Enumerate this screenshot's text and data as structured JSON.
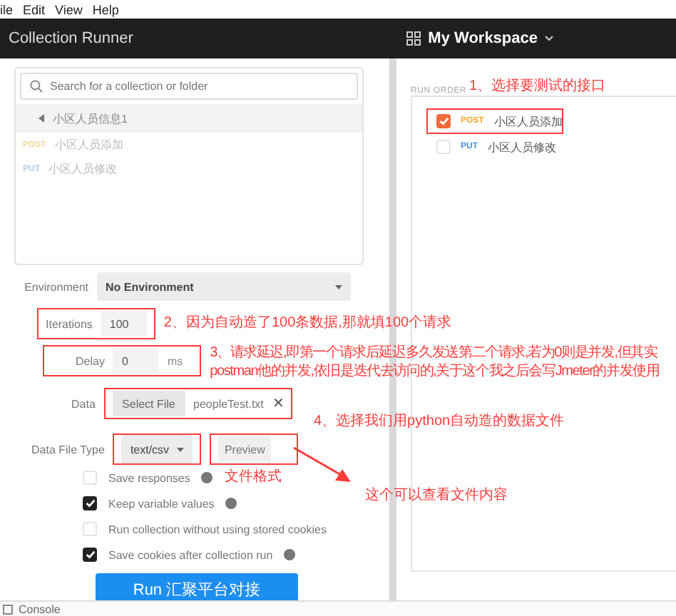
{
  "menu": [
    "ile",
    "Edit",
    "View",
    "Help"
  ],
  "header": {
    "title": "Collection Runner",
    "workspace": "My Workspace"
  },
  "collections": {
    "placeholder": "Search for a collection or folder",
    "folder": "小区人员信息1",
    "requests": [
      {
        "method": "POST",
        "name": "小区人员添加"
      },
      {
        "method": "PUT",
        "name": "小区人员修改"
      }
    ]
  },
  "environment": {
    "label": "Environment",
    "value": "No Environment"
  },
  "iterations": {
    "label": "Iterations",
    "value": "100",
    "highlighted": true,
    "note": "2、因为自动造了100条数据,那就填100个请求"
  },
  "delay": {
    "label": "Delay",
    "value": "0",
    "unit": "ms",
    "highlighted": true,
    "note": [
      "3、请求延迟,即第一个请求后延迟多久发送第二个请求,若为0则是并发,但其实",
      "postman他的并发,依旧是迭代去访问的,关于这个我之后会写Jmeter的并发使用"
    ]
  },
  "data": {
    "label": "Data",
    "button": "Select File",
    "file": "peopleTest.txt",
    "clear": "✕",
    "highlighted": true,
    "note": "4、选择我们用python自动造的数据文件"
  },
  "data_file_type": {
    "label": "Data File Type",
    "value": "text/csv",
    "highlighted": true,
    "preview": "Preview",
    "preview_highlighted": true,
    "note": "文件格式",
    "preview_note": "这个可以查看文件内容"
  },
  "options": [
    {
      "label": "Save responses",
      "checked": false,
      "info": true
    },
    {
      "label": "Keep variable values",
      "checked": true,
      "info": true
    },
    {
      "label": "Run collection without using stored cookies",
      "checked": false,
      "info": false
    },
    {
      "label": "Save cookies after collection run",
      "checked": true,
      "info": true
    }
  ],
  "run_button": "Run 汇聚平台对接",
  "console": "Console",
  "run_order": {
    "title": "RUN ORDER",
    "note": "1、选择要测试的接口",
    "items": [
      {
        "method": "POST",
        "name": "小区人员添加",
        "checked": true,
        "highlighted": true
      },
      {
        "method": "PUT",
        "name": "小区人员修改",
        "checked": false,
        "highlighted": false
      }
    ]
  }
}
